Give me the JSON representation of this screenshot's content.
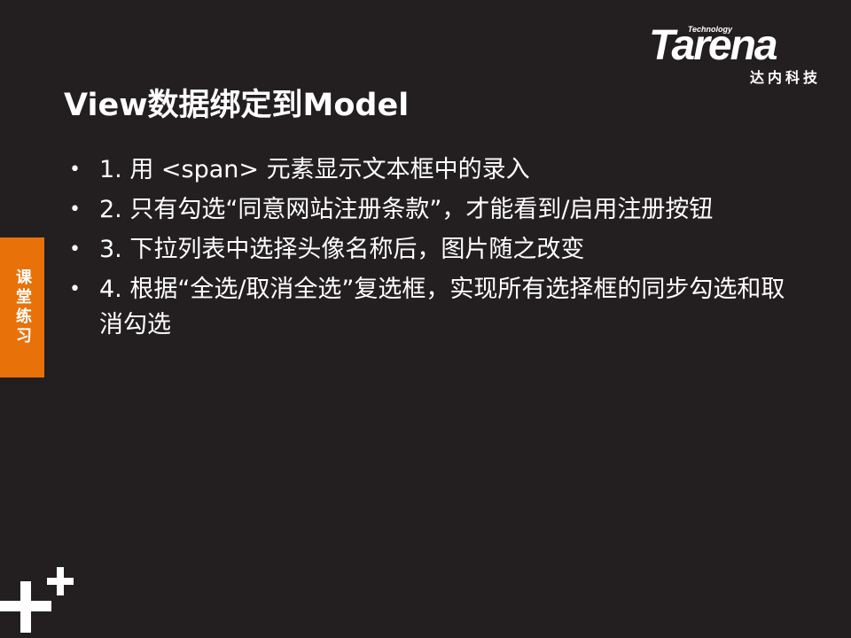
{
  "logo": {
    "technology": "Technology",
    "wordmark": "Tarena",
    "chinese": "达内科技"
  },
  "slide": {
    "title": "View数据绑定到Model",
    "side_tab": "课堂练习",
    "bullets": [
      "1. 用 <span> 元素显示文本框中的录入",
      "2. 只有勾选“同意网站注册条款”，才能看到/启用注册按钮",
      "3. 下拉列表中选择头像名称后，图片随之改变",
      "4. 根据“全选/取消全选”复选框，实现所有选择框的同步勾选和取消勾选"
    ]
  },
  "colors": {
    "background": "#231f20",
    "accent": "#e8710a",
    "text": "#ffffff"
  }
}
